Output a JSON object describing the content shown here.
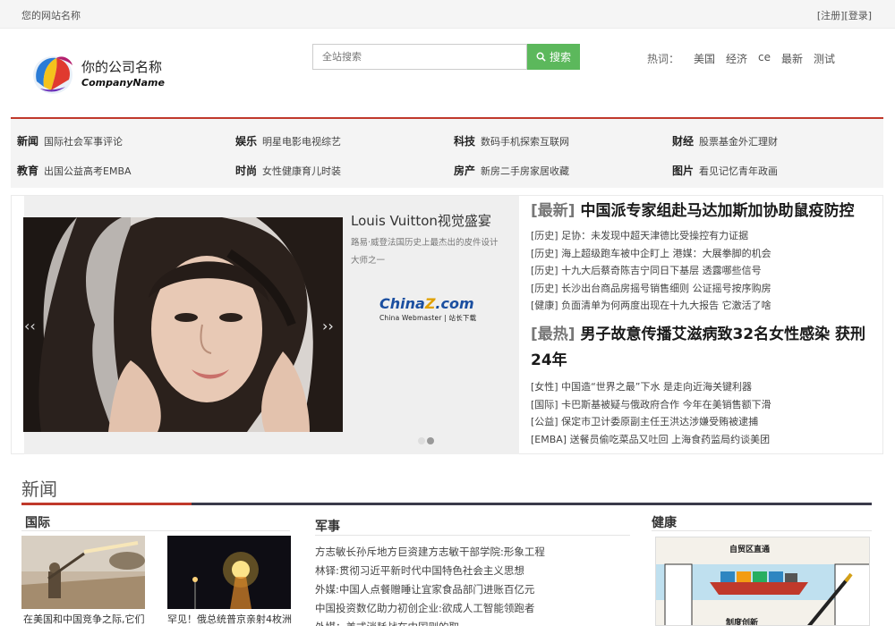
{
  "topbar": {
    "site_name": "您的网站名称",
    "register": "[注册]",
    "login": "[登录]"
  },
  "header": {
    "company_name": "你的公司名称",
    "company_en": "CompanyName",
    "search_placeholder": "全站搜索",
    "search_button": "搜索",
    "hot_label": "热词：",
    "hot_words": [
      "美国",
      "经济",
      "ce",
      "最新",
      "测试"
    ]
  },
  "nav": [
    {
      "cat": "新闻",
      "items": [
        "国际",
        "社会",
        "军事",
        "评论"
      ]
    },
    {
      "cat": "娱乐",
      "items": [
        "明星",
        "电影",
        "电视",
        "综艺"
      ]
    },
    {
      "cat": "科技",
      "items": [
        "数码",
        "手机",
        "探索",
        "互联网"
      ]
    },
    {
      "cat": "财经",
      "items": [
        "股票",
        "基金",
        "外汇",
        "理财"
      ]
    },
    {
      "cat": "教育",
      "items": [
        "出国",
        "公益",
        "高考",
        "EMBA"
      ]
    },
    {
      "cat": "时尚",
      "items": [
        "女性",
        "健康",
        "育儿",
        "时装"
      ]
    },
    {
      "cat": "房产",
      "items": [
        "新房",
        "二手房",
        "家居",
        "收藏"
      ]
    },
    {
      "cat": "图片",
      "items": [
        "看见",
        "记忆",
        "青年",
        "政画"
      ]
    }
  ],
  "slider": {
    "title": "Louis Vuitton视觉盛宴",
    "desc": "路易·威登法国历史上最杰出的皮件设计大师之一",
    "watermark_main": "China",
    "watermark_z": "Z",
    "watermark_tail": ".com",
    "watermark_sub": "China Webmaster | 站长下载",
    "prev": "‹‹",
    "next": "››",
    "slide_count": 2,
    "active_slide": 2
  },
  "feature": {
    "headline1_tag": "[最新]",
    "headline1": "中国派专家组赴马达加斯加协助鼠疫防控",
    "list1": [
      "[历史] 足协：未发现中超天津德比受操控有力证据",
      "[历史] 海上超级跑车被中企盯上 港媒：大展拳脚的机会",
      "[历史] 十九大后蔡奇陈吉宁同日下基层 透露哪些信号",
      "[历史] 长沙出台商品房摇号销售细则 公证摇号按序购房",
      "[健康] 负面清单为何两度出现在十九大报告 它激活了啥"
    ],
    "headline2_tag": "[最热]",
    "headline2_a": "男子故意传播艾滋病致32名女性感染 获刑",
    "headline2_b": "24年",
    "list2": [
      "[女性] 中国造“世界之最”下水 是走向近海关键利器",
      "[国际] 卡巴斯基被疑与俄政府合作 今年在美销售额下滑",
      "[公益] 保定市卫计委原副主任王洪达涉嫌受贿被逮捕",
      "[EMBA] 送餐员偷吃菜品又吐回 上海食药监局约谈美团"
    ]
  },
  "section": {
    "title": "新闻",
    "col1_title": "国际",
    "col1_captions": [
      "在美国和中国竞争之际,它们",
      "罕见！俄总统普京亲射4枚洲"
    ],
    "col2_title": "军事",
    "col2_items": [
      "方志敏长孙斥地方巨资建方志敏干部学院:形象工程",
      "林铎:贯彻习近平新时代中国特色社会主义思想",
      "外媒:中国人点餐贈睡让宜家食品部门进账百亿元",
      "中国投资数亿助力初创企业:欲成人工智能领跑者",
      "外媒：美式消耗战在中国则的取"
    ],
    "col3_title": "健康",
    "health_img_labels": [
      "自贸区直通",
      "制度创新"
    ]
  }
}
